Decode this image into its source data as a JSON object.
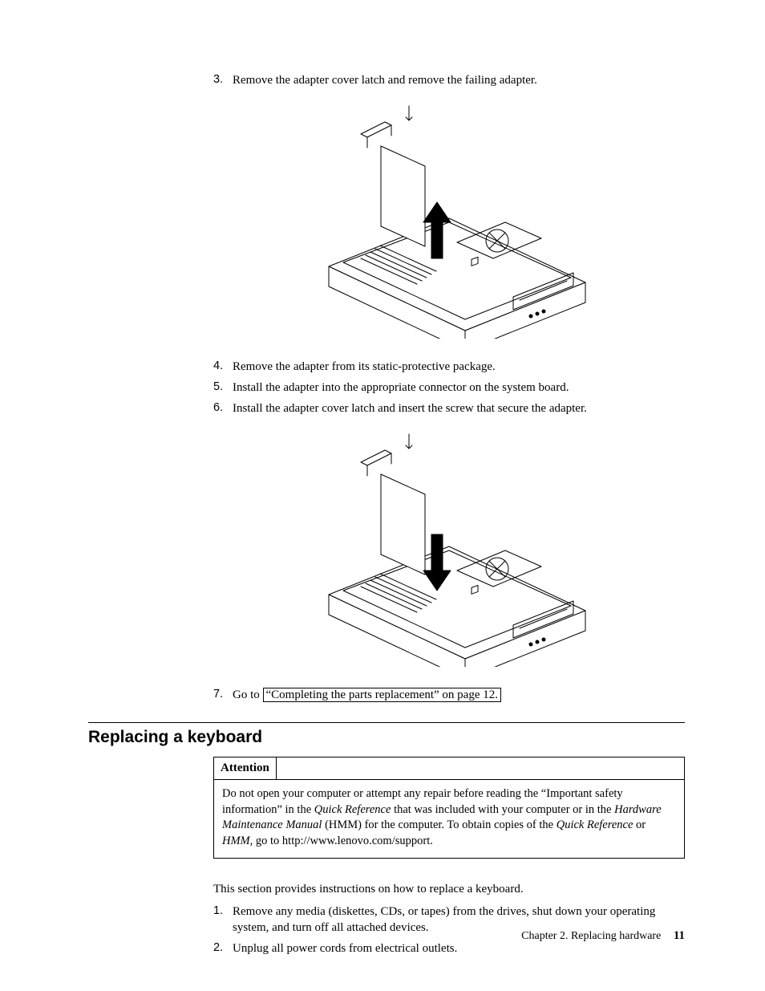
{
  "steps_a": {
    "s3": {
      "num": "3.",
      "text": "Remove the adapter cover latch and remove the failing adapter."
    },
    "s4": {
      "num": "4.",
      "text": "Remove the adapter from its static-protective package."
    },
    "s5": {
      "num": "5.",
      "text": "Install the adapter into the appropriate connector on the system board."
    },
    "s6": {
      "num": "6.",
      "text": "Install the adapter cover latch and insert the screw that secure the adapter."
    },
    "s7": {
      "num": "7.",
      "prefix": "Go to ",
      "link": "“Completing the parts replacement” on page 12."
    }
  },
  "section": {
    "title": "Replacing a keyboard",
    "attention_label": "Attention",
    "attention_body_parts": {
      "p1": "Do not open your computer or attempt any repair before reading the “Important safety information” in the ",
      "i1": "Quick Reference",
      "p2": " that was included with your computer or in the ",
      "i2": "Hardware Maintenance Manual",
      "p3": " (HMM) for the computer. To obtain copies of the ",
      "i3": "Quick Reference",
      "p4": " or ",
      "i4": "HMM",
      "p5": ", go to http://www.lenovo.com/support."
    },
    "intro": "This section provides instructions on how to replace a keyboard."
  },
  "steps_b": {
    "s1": {
      "num": "1.",
      "text": "Remove any media (diskettes, CDs, or tapes) from the drives, shut down your operating system, and turn off all attached devices."
    },
    "s2": {
      "num": "2.",
      "text": "Unplug all power cords from electrical outlets."
    }
  },
  "footer": {
    "chapter": "Chapter 2. Replacing hardware",
    "page": "11"
  }
}
